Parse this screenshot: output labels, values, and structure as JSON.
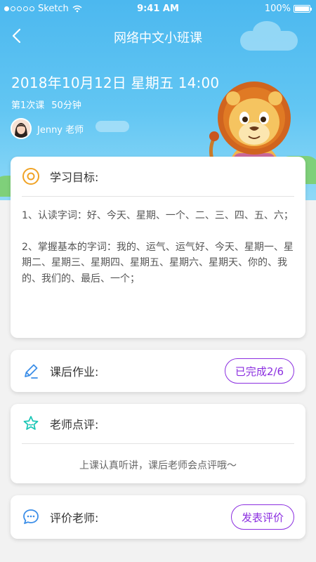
{
  "status_bar": {
    "carrier": "Sketch",
    "time": "9:41 AM",
    "battery": "100%"
  },
  "nav": {
    "title": "网络中文小班课",
    "back_icon": "chevron-left-icon"
  },
  "lesson": {
    "datetime": "2018年10月12日 星期五 14:00",
    "session": "第1次课",
    "duration": "50分钟",
    "teacher": "Jenny 老师"
  },
  "goals": {
    "title": "学习目标:",
    "icon": "target-icon",
    "items": [
      "1、认读字词：好、今天、星期、一个、二、三、四、五、六；",
      "2、掌握基本的字词：我的、运气、运气好、今天、星期一、星期二、星期三、星期四、星期五、星期六、星期天、你的、我的、我们的、最后、一个；"
    ]
  },
  "homework": {
    "title": "课后作业:",
    "icon": "pencil-icon",
    "status": "已完成2/6"
  },
  "review": {
    "title": "老师点评:",
    "icon": "star-icon",
    "text": "上课认真听讲，课后老师会点评哦～"
  },
  "rate": {
    "title": "评价老师:",
    "icon": "chat-bubble-icon",
    "button": "发表评价"
  },
  "colors": {
    "sky": "#4cb8ef",
    "accent_purple": "#8b2ee0",
    "icon_orange": "#f0a326",
    "icon_blue": "#3b8ee8",
    "icon_teal": "#1fc7b7"
  }
}
